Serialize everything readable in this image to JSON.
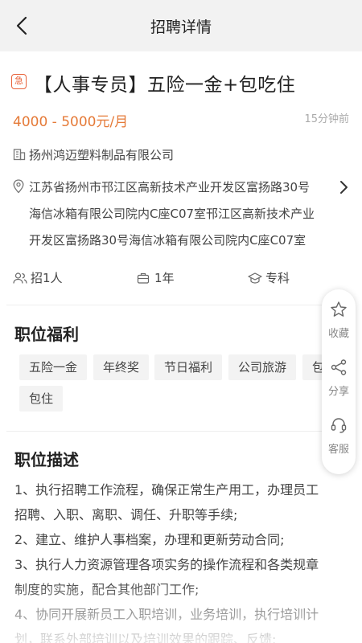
{
  "header": {
    "title": "招聘详情"
  },
  "job": {
    "urgent_label": "急",
    "title": "【人事专员】五险一金+包吃住",
    "salary": "4000 - 5000元/月",
    "posted": "15分钟前",
    "company": "扬州鸿迈塑料制品有限公司",
    "address_lines": [
      "江苏省扬州市邗江区高新技术产业开发区富扬路30号",
      "海信冰箱有限公司院内C座C07室邗江区高新技术产业",
      "开发区富扬路30号海信冰箱有限公司院内C座C07室"
    ],
    "headcount": "招1人",
    "experience": "1年",
    "education": "专科"
  },
  "benefits": {
    "title": "职位福利",
    "tags": [
      "五险一金",
      "年终奖",
      "节日福利",
      "公司旅游",
      "包吃",
      "包住"
    ]
  },
  "description": {
    "title": "职位描述",
    "lines": [
      "1、执行招聘工作流程，确保正常生产用工，办理员工",
      "招聘、入职、离职、调任、升职等手续;",
      "2、建立、维护人事档案，办理和更新劳动合同;",
      "3、执行人力资源管理各项实务的操作流程和各类规章",
      "制度的实施，配合其他部门工作;",
      "4、协同开展新员工入职培训，业务培训，执行培训计",
      "划，联系外部培训以及培训效果的跟踪、反馈;"
    ]
  },
  "actions": {
    "favorite": "收藏",
    "share": "分享",
    "service": "客服"
  },
  "colors": {
    "accent": "#e57a38",
    "badge": "#e8623a"
  }
}
